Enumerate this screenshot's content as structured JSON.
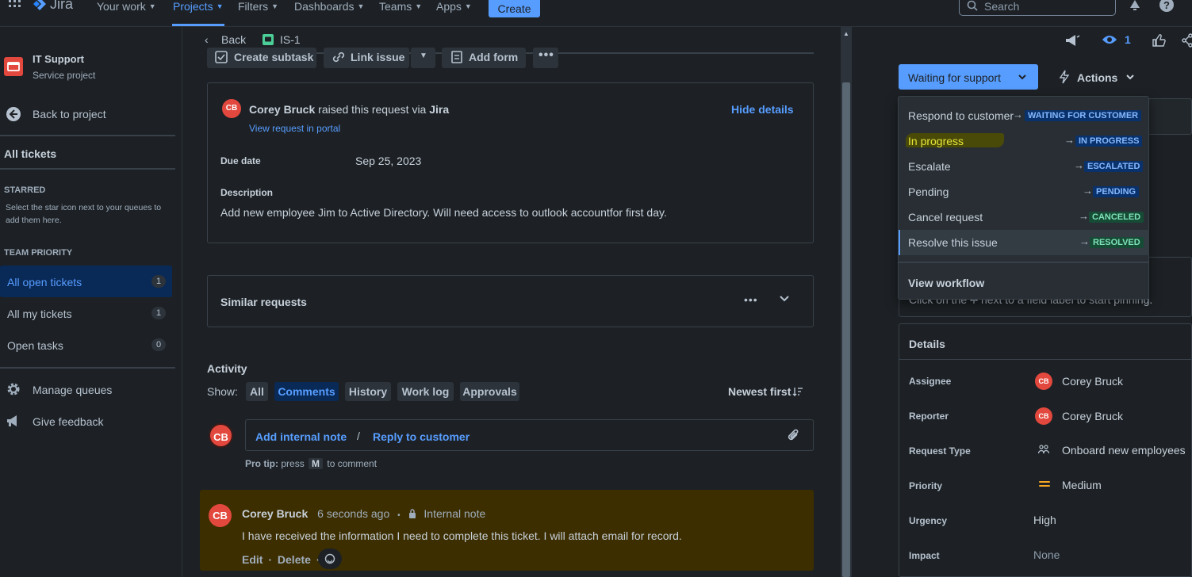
{
  "nav": {
    "app_name": "Jira",
    "items": [
      {
        "label": "Your work"
      },
      {
        "label": "Projects"
      },
      {
        "label": "Filters"
      },
      {
        "label": "Dashboards"
      },
      {
        "label": "Teams"
      },
      {
        "label": "Apps"
      }
    ],
    "create_label": "Create",
    "search_placeholder": "Search"
  },
  "sidebar": {
    "project_name": "IT Support",
    "project_type": "Service project",
    "back_label": "Back to project",
    "all_tickets": "All tickets",
    "starred_heading": "STARRED",
    "starred_hint_1": "Select the star icon next to your queues to",
    "starred_hint_2": "add them here.",
    "team_priority_heading": "TEAM PRIORITY",
    "queues": [
      {
        "label": "All open tickets",
        "count": "1"
      },
      {
        "label": "All my tickets",
        "count": "1"
      },
      {
        "label": "Open tasks",
        "count": "0"
      }
    ],
    "manage_queues": "Manage queues",
    "give_feedback": "Give feedback"
  },
  "issue": {
    "back_label": "Back",
    "key": "IS-1",
    "toolbar": {
      "create_subtask": "Create subtask",
      "link_issue": "Link issue",
      "add_form": "Add form"
    },
    "reporter_initials": "CB",
    "raised_by_name": "Corey Bruck",
    "raised_text": " raised this request via ",
    "raised_via": "Jira",
    "view_portal": "View request in portal",
    "hide_details": "Hide details",
    "due_date_label": "Due date",
    "due_date_value": "Sep 25, 2023",
    "description_label": "Description",
    "description_text": "Add new employee Jim to Active Directory. Will need access to outlook accountfor first day.",
    "similar_requests": "Similar requests"
  },
  "activity": {
    "heading": "Activity",
    "show_label": "Show:",
    "filters": [
      "All",
      "Comments",
      "History",
      "Work log",
      "Approvals"
    ],
    "selected_filter": "Comments",
    "sort_label": "Newest first",
    "add_internal_note": "Add internal note",
    "separator": "/",
    "reply_to_customer": "Reply to customer",
    "pro_tip_label": "Pro tip:",
    "pro_tip_press": "press",
    "pro_tip_key": "M",
    "pro_tip_suffix": "to comment",
    "comment": {
      "initials": "CB",
      "author": "Corey Bruck",
      "time": "6 seconds ago",
      "bullet": "•",
      "visibility": "Internal note",
      "text": "I have received the information I need to complete this ticket. I will attach email for record.",
      "edit": "Edit",
      "dot": "·",
      "delete": "Delete",
      "dot2": "·"
    }
  },
  "right_panel": {
    "watch_count": "1",
    "status_button": "Waiting for support",
    "actions_label": "Actions",
    "transitions": [
      {
        "label": "Respond to customer",
        "arrow": "→",
        "status": "WAITING FOR CUSTOMER",
        "color": "blue"
      },
      {
        "label": "In progress",
        "arrow": "→",
        "status": "IN PROGRESS",
        "color": "blue"
      },
      {
        "label": "Escalate",
        "arrow": "→",
        "status": "ESCALATED",
        "color": "blue"
      },
      {
        "label": "Pending",
        "arrow": "→",
        "status": "PENDING",
        "color": "blue"
      },
      {
        "label": "Cancel request",
        "arrow": "→",
        "status": "CANCELED",
        "color": "green"
      },
      {
        "label": "Resolve this issue",
        "arrow": "→",
        "status": "RESOLVED",
        "color": "green"
      }
    ],
    "view_workflow": "View workflow",
    "pinned_hint_start": "Click on the",
    "pinned_hint_end": "next to a field label to start pinning.",
    "details_heading": "Details",
    "fields": [
      {
        "label": "Assignee",
        "value": "Corey Bruck",
        "initials": "CB"
      },
      {
        "label": "Reporter",
        "value": "Corey Bruck",
        "initials": "CB"
      },
      {
        "label": "Request Type",
        "value": "Onboard new employees"
      },
      {
        "label": "Priority",
        "value": "Medium"
      },
      {
        "label": "Urgency",
        "value": "High"
      },
      {
        "label": "Impact",
        "value": "None"
      }
    ]
  },
  "colors": {
    "accent": "#579dff",
    "avatar": "#e2483d",
    "internal_note_bg": "#3d2e00",
    "highlight_marker": "#4a4a08",
    "priority_medium": "#f5a623"
  }
}
